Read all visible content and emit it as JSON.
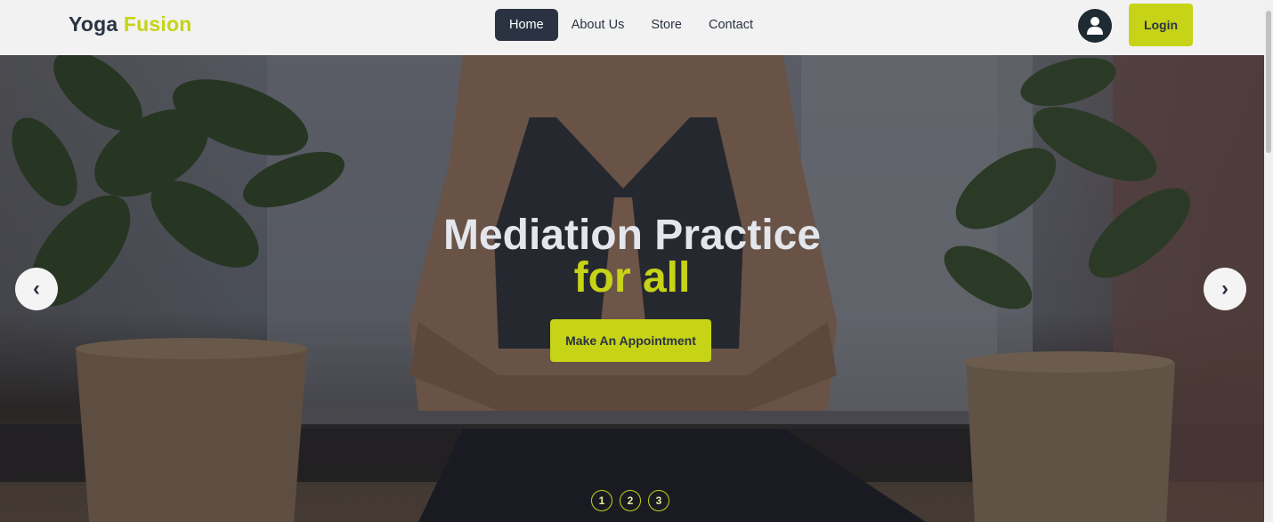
{
  "brand": {
    "name_part1": "Yoga",
    "name_part2": "Fusion"
  },
  "nav": {
    "items": [
      {
        "label": "Home",
        "active": true
      },
      {
        "label": "About Us",
        "active": false
      },
      {
        "label": "Store",
        "active": false
      },
      {
        "label": "Contact",
        "active": false
      }
    ]
  },
  "header": {
    "user_icon": "user-icon",
    "login_label": "Login"
  },
  "hero": {
    "title": "Mediation Practice",
    "subtitle": "for all",
    "cta_label": "Make An Appointment",
    "prev_symbol": "‹",
    "next_symbol": "›",
    "slides": [
      "1",
      "2",
      "3"
    ]
  },
  "colors": {
    "accent": "#c6d316",
    "dark": "#2b3342"
  }
}
